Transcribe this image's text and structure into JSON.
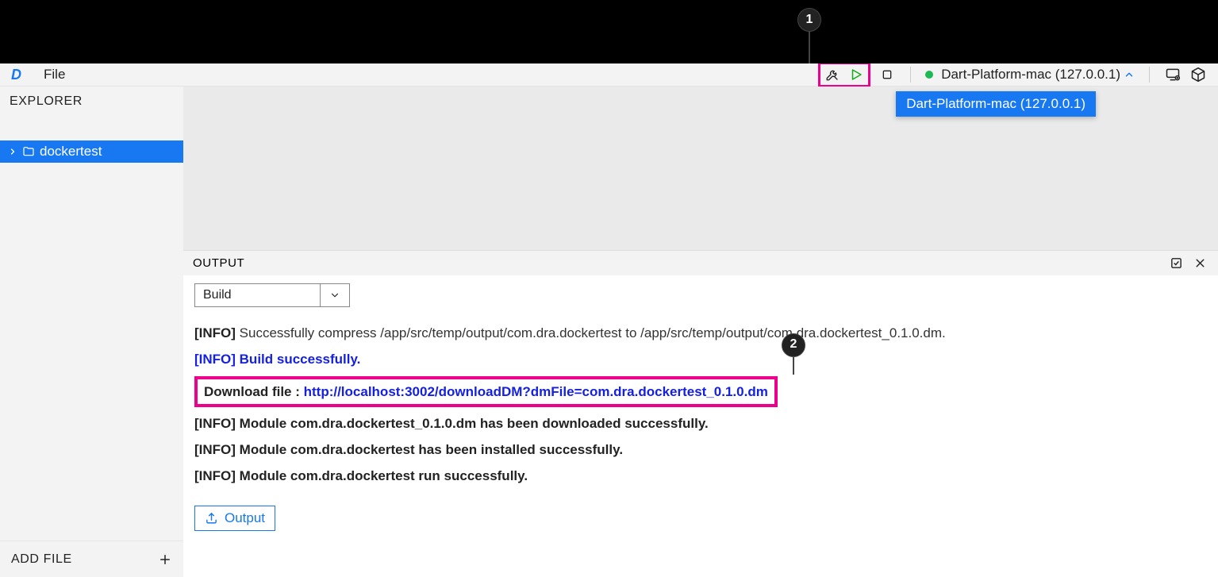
{
  "annotations": {
    "one": "1",
    "two": "2"
  },
  "menubar": {
    "file": "File"
  },
  "toolbar": {
    "platform_label": "Dart-Platform-mac (127.0.0.1)",
    "dropdown_item": "Dart-Platform-mac (127.0.0.1)"
  },
  "sidebar": {
    "explorer_title": "EXPLORER",
    "tree_root": "dockertest",
    "add_file_label": "ADD FILE"
  },
  "output": {
    "panel_title": "OUTPUT",
    "select_value": "Build",
    "button_label": "Output",
    "logs": {
      "l1_tag": "[INFO]",
      "l1_text": " Successfully compress /app/src/temp/output/com.dra.dockertest to /app/src/temp/output/com.dra.dockertest_0.1.0.dm.",
      "l2": "[INFO] Build successfully.",
      "l3_prefix": "Download file : ",
      "l3_link": "http://localhost:3002/downloadDM?dmFile=com.dra.dockertest_0.1.0.dm",
      "l4": "[INFO] Module com.dra.dockertest_0.1.0.dm has been downloaded successfully.",
      "l5": "[INFO] Module com.dra.dockertest has been installed successfully.",
      "l6": "[INFO] Module com.dra.dockertest run successfully."
    }
  }
}
